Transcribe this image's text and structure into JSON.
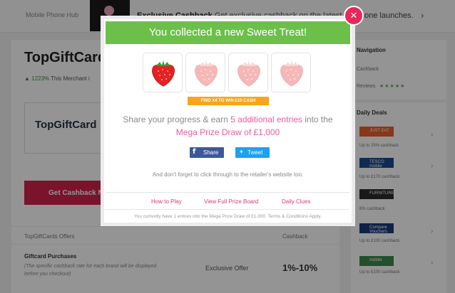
{
  "background": {
    "banner_left": "Mobile Phone Hub",
    "banner_text_bold": "Exclusive Cashback",
    "banner_text": "Get exclusive cashback on the latest M",
    "banner_right": "hone launches.",
    "merchant_title": "TopGiftCard",
    "merchant_stat_up": "▲ 1223%",
    "merchant_stat": "This Merchant i",
    "logo_text": "TopGiftCard",
    "get_cashback_label": "Get Cashback N",
    "offers_header_left": "TopGiftCards Offers",
    "offers_header_right": "Cashback",
    "offer_name": "Giftcard Purchases",
    "offer_note": "(The specific cashback rate for each brand will be displayed before you checkout)",
    "offer_type": "Exclusive Offer",
    "offer_rate": "1%-10%"
  },
  "sidebar": {
    "nav_heading": "Navigation",
    "nav_items": [
      "Cashback",
      "Reviews"
    ],
    "review_stars": "★★★★★",
    "deals_heading": "Daily Deals",
    "deals": [
      {
        "logo": "JUST EAT",
        "text": "Up to 25% cashback",
        "color": "#e8612c"
      },
      {
        "logo": "TESCO mobile",
        "text": "Up to £170 cashback",
        "color": "#1a4a8f"
      },
      {
        "logo": "FURNITURECHOICE",
        "text": "8% cashback",
        "color": "#2b2b2b"
      },
      {
        "logo": "Compare Vouchers",
        "text": "Up to £100 cashback",
        "color": "#1b3a78"
      },
      {
        "logo": "mobile",
        "text": "Up to £100 cashback",
        "color": "#3c8a4a"
      }
    ]
  },
  "modal": {
    "title": "You collected a new Sweet Treat!",
    "close_label": "×",
    "treats_collected": 1,
    "treats_total": 4,
    "find_badge": "FIND X4 TO WIN £10 CASH",
    "share_prefix": "Share your progress & earn ",
    "share_highlight": "5 additional entries",
    "share_mid": " into the",
    "prize_name": "Mega Prize Draw of £1,000",
    "facebook": {
      "icon": "f",
      "label": "Share"
    },
    "twitter": {
      "icon": "🐦",
      "label": "Tweet"
    },
    "forget_text": "And don't forget to click through to the retailer's website too.",
    "links": [
      "How to Play",
      "View Full Prize Board",
      "Daily Clues"
    ],
    "footer": "You currently have 1 entries into the Mega Prize Draw of £1,000. Terms & Conditions Apply.",
    "colors": {
      "header": "#6cc04a",
      "accent": "#e85b9e",
      "close": "#e8285b",
      "badge": "#f8a51b"
    }
  }
}
